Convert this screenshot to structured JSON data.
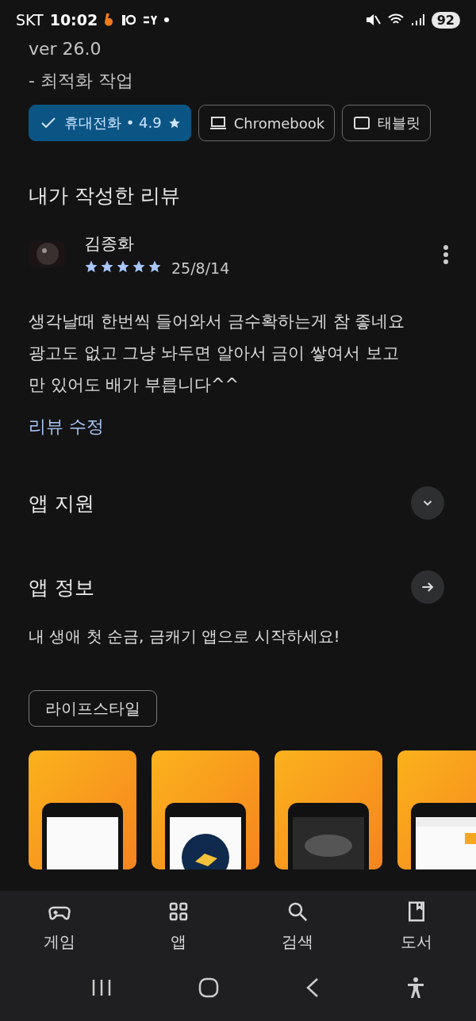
{
  "status_bar": {
    "carrier": "SKT",
    "time": "10:02",
    "battery": "92"
  },
  "release_notes": [
    "ver 26.0",
    "- 최적화 작업"
  ],
  "device_chips": [
    {
      "label": "휴대전화 • 4.9",
      "kind": "phone",
      "selected": true
    },
    {
      "label": "Chromebook",
      "kind": "laptop",
      "selected": false
    },
    {
      "label": "태블릿",
      "kind": "tablet",
      "selected": false
    }
  ],
  "my_review": {
    "heading": "내가 작성한 리뷰",
    "reviewer": "김종화",
    "stars": 5,
    "date": "25/8/14",
    "text": "생각날때 한번씩 들어와서 금수확하는게 참 좋네요 광고도 없고 그냥 놔두면 알아서 금이 쌓여서 보고만 있어도 배가 부릅니다^^",
    "edit_link": "리뷰 수정"
  },
  "sections": [
    {
      "title": "앱 지원",
      "kind": "expand",
      "expanded": false
    },
    {
      "title": "앱 정보",
      "kind": "navigate"
    }
  ],
  "app_description": "내 생애 첫 순금, 금캐기 앱으로 시작하세요!",
  "category_chip": "라이프스타일",
  "screenshots": [
    {
      "kind": "picture"
    },
    {
      "kind": "picture"
    },
    {
      "kind": "picture"
    },
    {
      "kind": "picture"
    }
  ],
  "bottom_nav": [
    {
      "label": "게임"
    },
    {
      "label": "앱"
    },
    {
      "label": "검색"
    },
    {
      "label": "도서"
    }
  ]
}
